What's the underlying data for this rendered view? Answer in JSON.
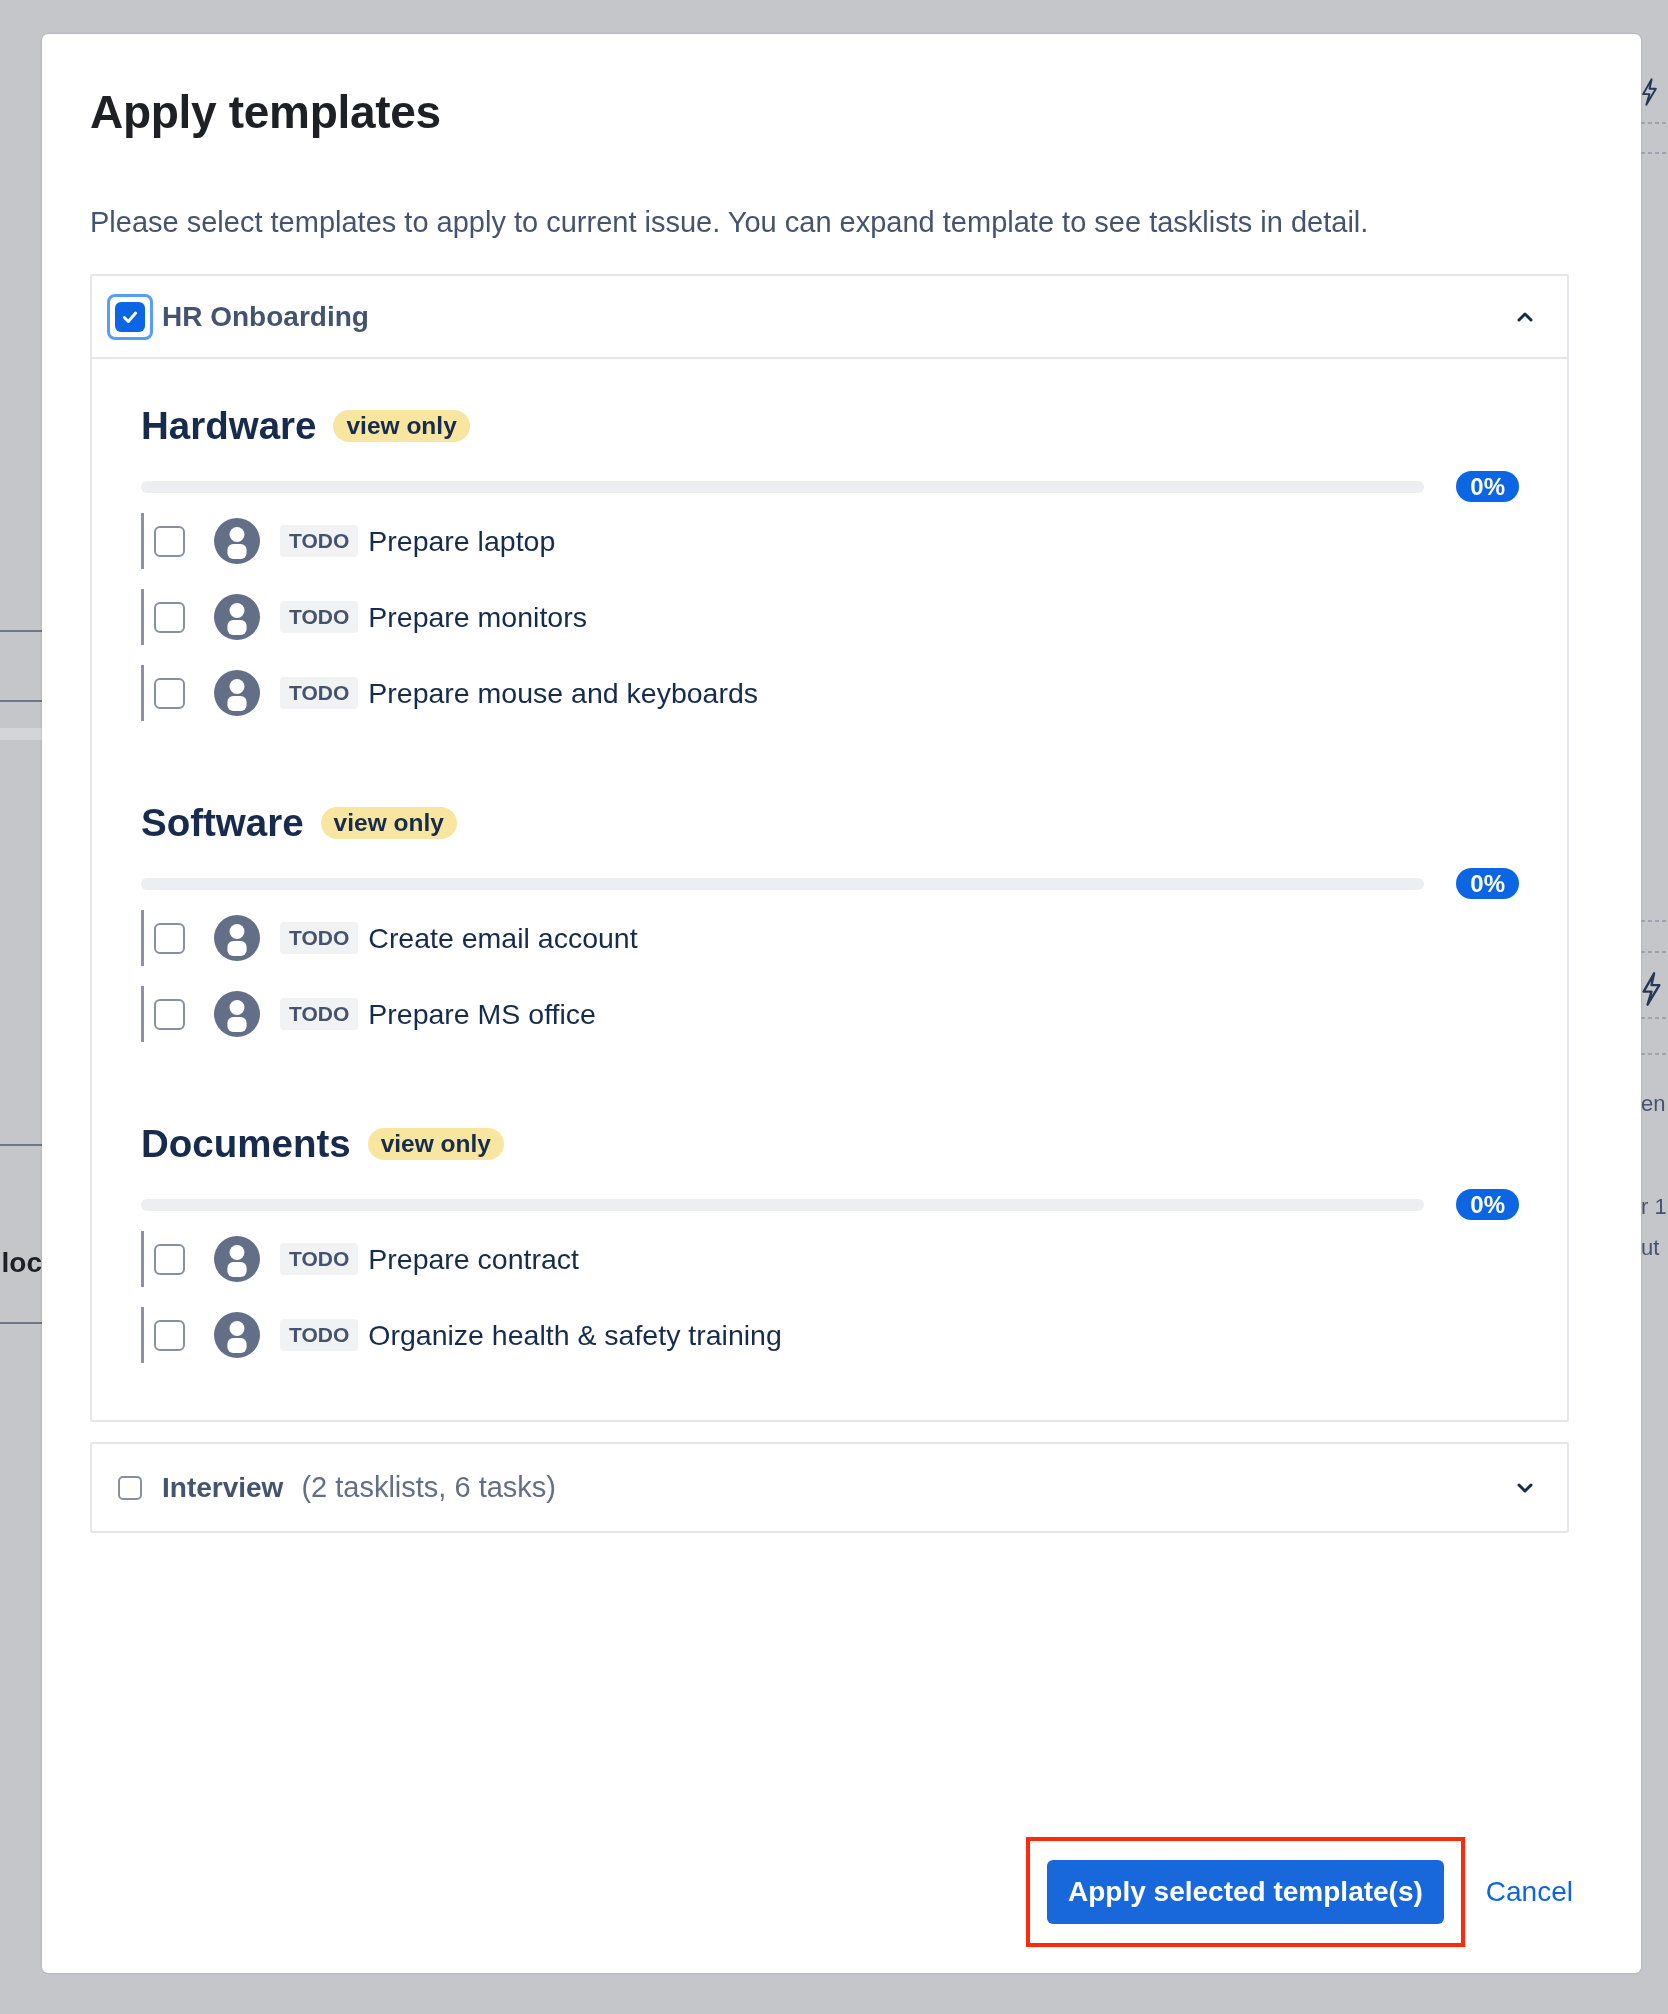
{
  "dialog": {
    "title": "Apply templates",
    "description": "Please select templates to apply to current issue. You can expand template to see tasklists in detail."
  },
  "templates": [
    {
      "name": "HR Onboarding",
      "checked": true,
      "focused": true,
      "expanded": true,
      "tasklists": [
        {
          "title": "Hardware",
          "badge": "view only",
          "level": 0,
          "progress": "0%",
          "tasks": [
            {
              "checked": false,
              "status": "TODO",
              "title": "Prepare laptop"
            },
            {
              "checked": false,
              "status": "TODO",
              "title": "Prepare monitors"
            },
            {
              "checked": false,
              "status": "TODO",
              "title": "Prepare mouse and keyboards"
            }
          ]
        },
        {
          "title": "Software",
          "badge": "view only",
          "level": 0,
          "progress": "0%",
          "tasks": [
            {
              "checked": false,
              "status": "TODO",
              "title": "Create email account"
            },
            {
              "checked": false,
              "status": "TODO",
              "title": "Prepare MS office"
            }
          ]
        },
        {
          "title": "Documents",
          "badge": "view only",
          "level": 0,
          "progress": "0%",
          "tasks": [
            {
              "checked": false,
              "status": "TODO",
              "title": "Prepare contract"
            },
            {
              "checked": false,
              "status": "TODO",
              "title": "Organize health & safety training"
            }
          ]
        }
      ]
    },
    {
      "name": "Interview",
      "summary": "(2 tasklists, 6 tasks)",
      "checked": false,
      "focused": false,
      "expanded": false
    }
  ],
  "footer": {
    "buttons": [
      {
        "kind": "primary",
        "label": "Apply selected template(s)",
        "highlighted": true
      },
      {
        "kind": "link",
        "label": "Cancel",
        "highlighted": false
      }
    ]
  },
  "background": {
    "left_texts": [
      "loc"
    ],
    "right_texts": [
      "en",
      "r 1",
      "ut"
    ]
  }
}
